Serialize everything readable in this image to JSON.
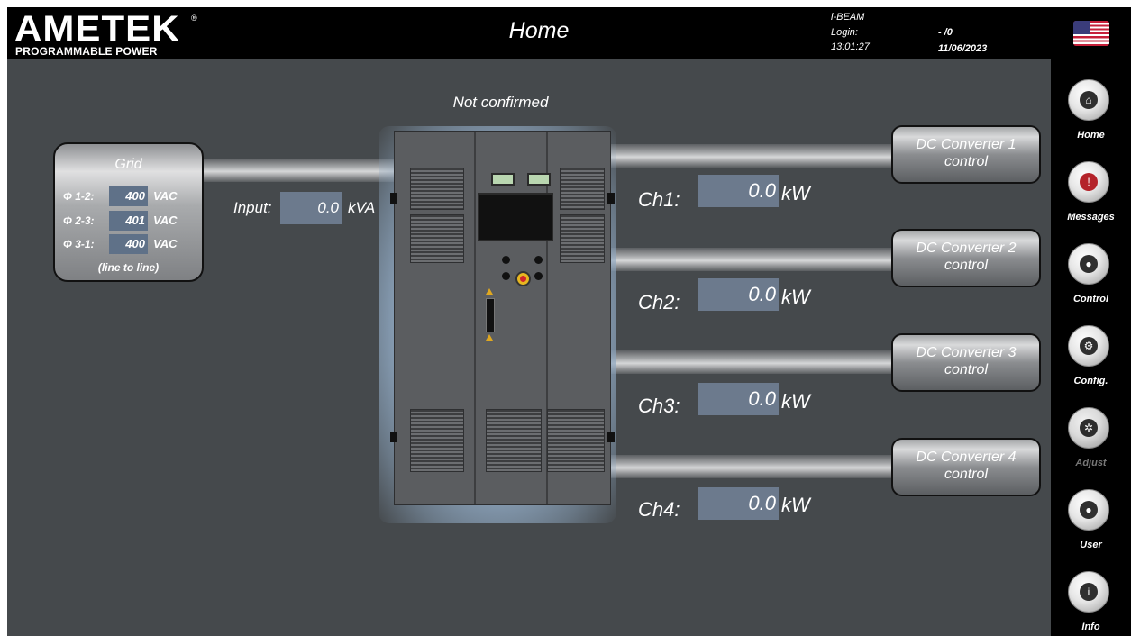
{
  "header": {
    "logo_text": "AMETEK",
    "logo_registered": "®",
    "logo_subtitle": "PROGRAMMABLE POWER",
    "page_title": "Home",
    "system_name": "i-BEAM",
    "login_label": "Login:",
    "login_value": "- /0",
    "time": "13:01:27",
    "date": "11/06/2023",
    "language_flag": "us-flag-icon"
  },
  "sidebar": {
    "items": [
      {
        "label": "Home",
        "icon": "home-icon",
        "glyph": "⌂"
      },
      {
        "label": "Messages",
        "icon": "warning-icon",
        "glyph": "!"
      },
      {
        "label": "Control",
        "icon": "control-icon",
        "glyph": "●"
      },
      {
        "label": "Config.",
        "icon": "gears-icon",
        "glyph": "⚙"
      },
      {
        "label": "Adjust",
        "icon": "adjust-icon",
        "glyph": "✲",
        "disabled": true
      },
      {
        "label": "User",
        "icon": "user-icon",
        "glyph": "●"
      },
      {
        "label": "Info",
        "icon": "info-icon",
        "glyph": "i"
      }
    ]
  },
  "main": {
    "status": "Not confirmed",
    "grid": {
      "title": "Grid",
      "phases": [
        {
          "label": "Φ 1-2:",
          "value": "400",
          "unit": "VAC"
        },
        {
          "label": "Φ 2-3:",
          "value": "401",
          "unit": "VAC"
        },
        {
          "label": "Φ 3-1:",
          "value": "400",
          "unit": "VAC"
        }
      ],
      "note": "(line to line)"
    },
    "input": {
      "label": "Input:",
      "value": "0.0",
      "unit": "kVA"
    },
    "channels": [
      {
        "label": "Ch1:",
        "value": "0.0",
        "unit": "kW",
        "converter": "DC Converter 1 control"
      },
      {
        "label": "Ch2:",
        "value": "0.0",
        "unit": "kW",
        "converter": "DC Converter 2 control"
      },
      {
        "label": "Ch3:",
        "value": "0.0",
        "unit": "kW",
        "converter": "DC Converter 3 control"
      },
      {
        "label": "Ch4:",
        "value": "0.0",
        "unit": "kW",
        "converter": "DC Converter 4 control"
      }
    ]
  },
  "colors": {
    "background": "#45494c",
    "header": "#000000",
    "value_box": "#6c7a8d",
    "alert_red": "#b4232a"
  }
}
